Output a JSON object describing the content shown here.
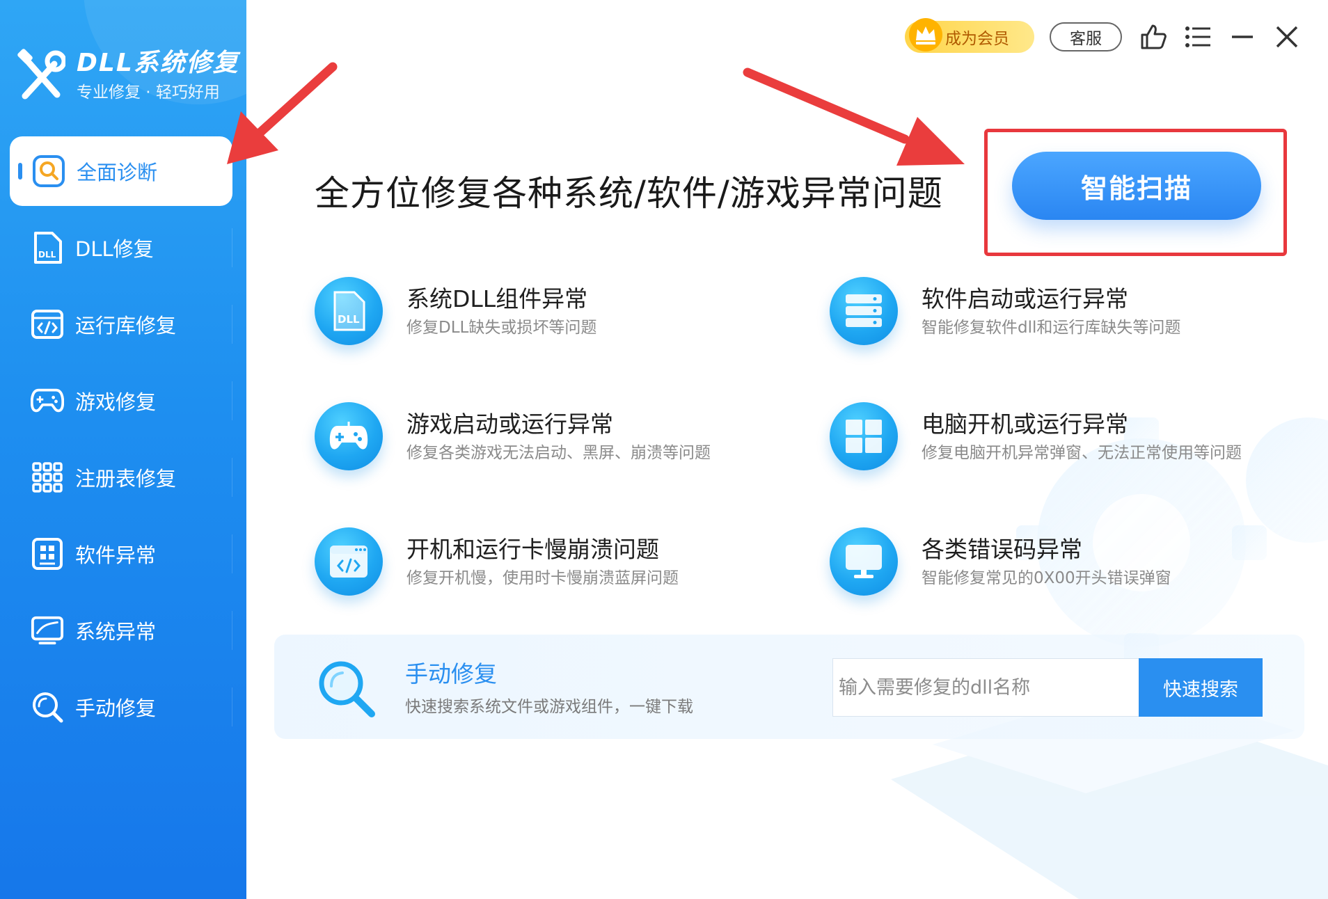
{
  "app": {
    "title": "DLL系统修复",
    "subtitle": "专业修复 · 轻巧好用"
  },
  "sidebar": {
    "items": [
      {
        "label": "全面诊断",
        "icon": "diagnose-icon",
        "active": true
      },
      {
        "label": "DLL修复",
        "icon": "dll-file-icon",
        "active": false
      },
      {
        "label": "运行库修复",
        "icon": "runtime-code-icon",
        "active": false
      },
      {
        "label": "游戏修复",
        "icon": "gamepad-icon",
        "active": false
      },
      {
        "label": "注册表修复",
        "icon": "registry-grid-icon",
        "active": false
      },
      {
        "label": "软件异常",
        "icon": "software-icon",
        "active": false
      },
      {
        "label": "系统异常",
        "icon": "system-monitor-icon",
        "active": false
      },
      {
        "label": "手动修复",
        "icon": "search-icon",
        "active": false
      }
    ]
  },
  "topbar": {
    "vip_label": "成为会员",
    "service_label": "客服",
    "icons": [
      "thumbs-up-icon",
      "menu-list-icon",
      "minimize-icon",
      "close-icon"
    ]
  },
  "main": {
    "headline": "全方位修复各种系统/软件/游戏异常问题",
    "scan_label": "智能扫描",
    "features": [
      {
        "title": "系统DLL组件异常",
        "desc": "修复DLL缺失或损坏等问题",
        "icon": "dll-file-icon"
      },
      {
        "title": "软件启动或运行异常",
        "desc": "智能修复软件dll和运行库缺失等问题",
        "icon": "server-stack-icon"
      },
      {
        "title": "游戏启动或运行异常",
        "desc": "修复各类游戏无法启动、黑屏、崩溃等问题",
        "icon": "gamepad-icon"
      },
      {
        "title": "电脑开机或运行异常",
        "desc": "修复电脑开机异常弹窗、无法正常使用等问题",
        "icon": "windows-icon"
      },
      {
        "title": "开机和运行卡慢崩溃问题",
        "desc": "修复开机慢，使用时卡慢崩溃蓝屏问题",
        "icon": "code-window-icon"
      },
      {
        "title": "各类错误码异常",
        "desc": "智能修复常见的0X00开头错误弹窗",
        "icon": "monitor-icon"
      }
    ]
  },
  "manual": {
    "title": "手动修复",
    "desc": "快速搜索系统文件或游戏组件，一键下载",
    "placeholder": "输入需要修复的dll名称",
    "search_label": "快速搜索"
  },
  "colors": {
    "sidebar": "#1e8ff0",
    "accent": "#2a8ff0",
    "highlight_frame": "#e8383d",
    "vip": "#ffd54a"
  }
}
